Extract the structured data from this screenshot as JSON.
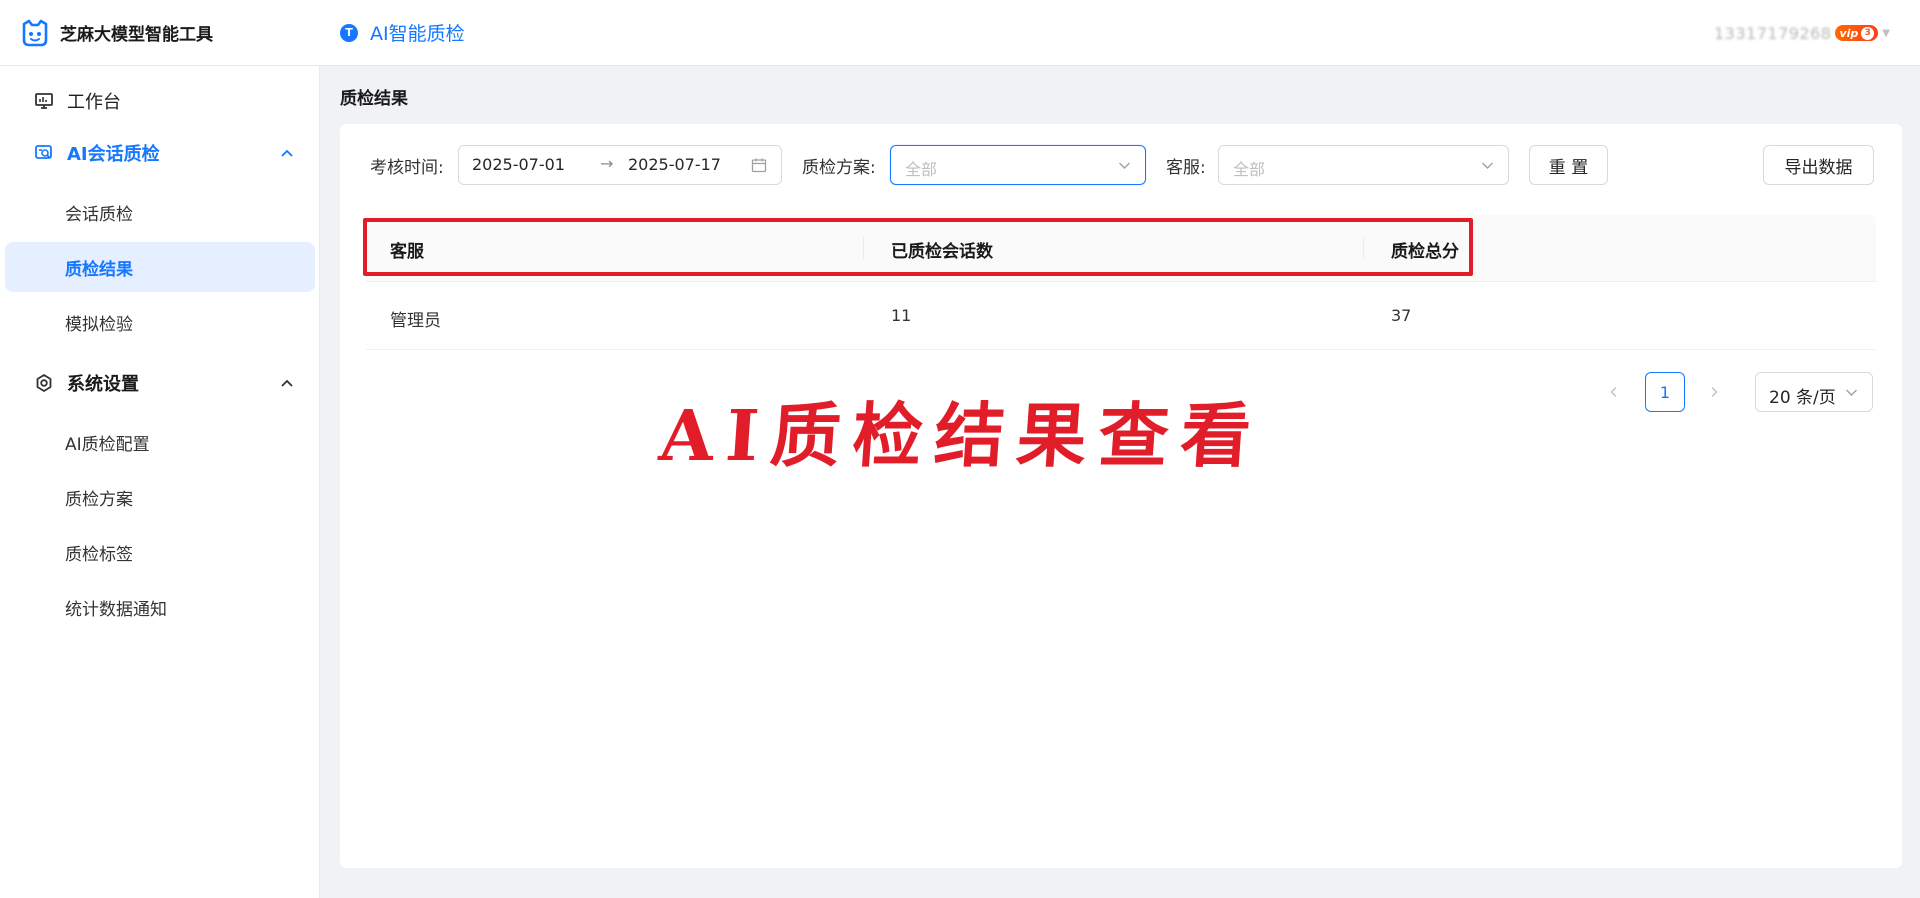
{
  "header": {
    "brand_name": "芝麻大模型智能工具",
    "module_icon_letter": "T",
    "module_name": "AI智能质检",
    "user_phone": "13317179268",
    "vip_label": "vip",
    "vip_level": "3"
  },
  "sidebar": {
    "workbench": "工作台",
    "group_ai": "AI会话质检",
    "ai_items": [
      "会话质检",
      "质检结果",
      "模拟检验"
    ],
    "group_settings": "系统设置",
    "settings_items": [
      "AI质检配置",
      "质检方案",
      "质检标签",
      "统计数据通知"
    ]
  },
  "page": {
    "title": "质检结果"
  },
  "filters": {
    "time_label": "考核时间:",
    "start_date": "2025-07-01",
    "range_arrow": "→",
    "end_date": "2025-07-17",
    "plan_label": "质检方案:",
    "plan_placeholder": "全部",
    "agent_label": "客服:",
    "agent_placeholder": "全部",
    "reset_label": "重 置",
    "export_label": "导出数据"
  },
  "table": {
    "columns": [
      "客服",
      "已质检会话数",
      "质检总分"
    ],
    "rows": [
      {
        "agent": "管理员",
        "sessions": "11",
        "score": "37"
      }
    ]
  },
  "pagination": {
    "current_page": "1",
    "page_size": "20 条/页"
  },
  "annotation": {
    "text": "AI质检结果查看"
  },
  "colors": {
    "accent": "#1677ff",
    "highlight": "#e11d2a"
  }
}
